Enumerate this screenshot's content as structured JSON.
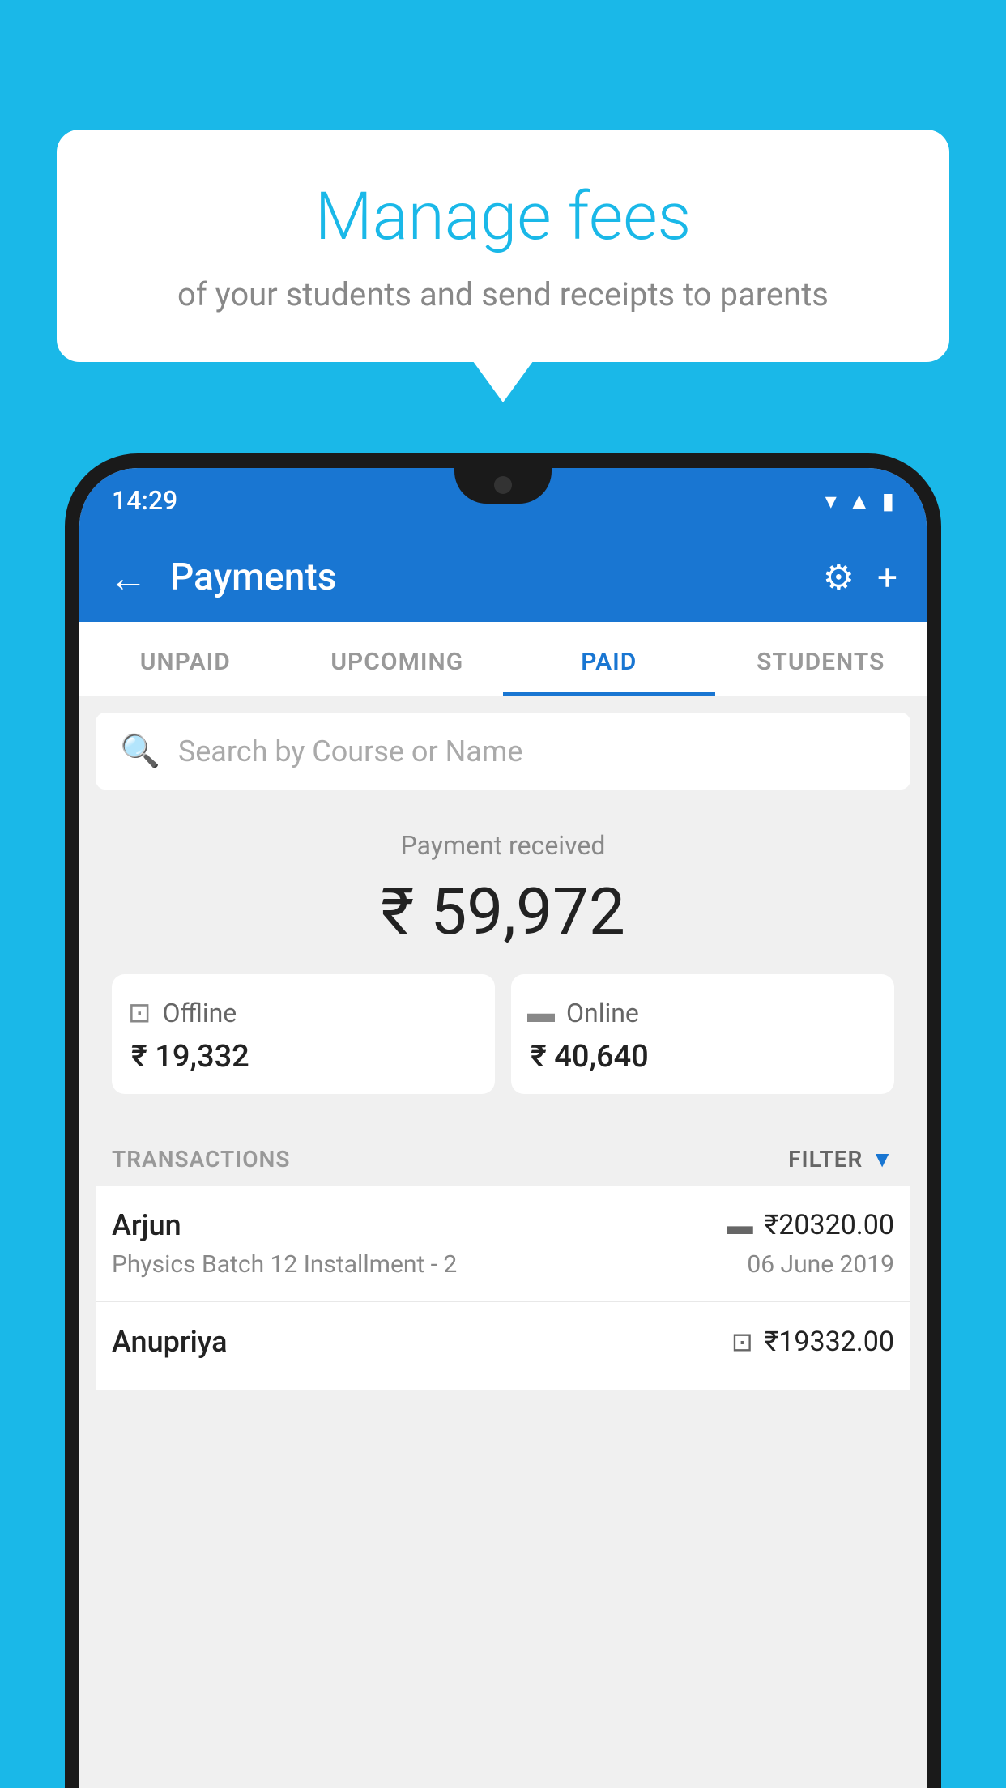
{
  "background": {
    "color": "#1ab8e8"
  },
  "bubble": {
    "title": "Manage fees",
    "subtitle": "of your students and send receipts to parents"
  },
  "status_bar": {
    "time": "14:29",
    "icons": [
      "wifi",
      "signal",
      "battery"
    ]
  },
  "header": {
    "title": "Payments",
    "back_label": "←",
    "settings_label": "⚙",
    "add_label": "+"
  },
  "tabs": [
    {
      "label": "UNPAID",
      "active": false
    },
    {
      "label": "UPCOMING",
      "active": false
    },
    {
      "label": "PAID",
      "active": true
    },
    {
      "label": "STUDENTS",
      "active": false
    }
  ],
  "search": {
    "placeholder": "Search by Course or Name"
  },
  "payment_summary": {
    "label": "Payment received",
    "amount": "₹ 59,972",
    "offline": {
      "type": "Offline",
      "amount": "₹ 19,332"
    },
    "online": {
      "type": "Online",
      "amount": "₹ 40,640"
    }
  },
  "transactions": {
    "label": "TRANSACTIONS",
    "filter_label": "FILTER",
    "items": [
      {
        "name": "Arjun",
        "course": "Physics Batch 12 Installment - 2",
        "amount": "₹20320.00",
        "date": "06 June 2019",
        "payment_type": "card"
      },
      {
        "name": "Anupriya",
        "course": "",
        "amount": "₹19332.00",
        "date": "",
        "payment_type": "cash"
      }
    ]
  }
}
